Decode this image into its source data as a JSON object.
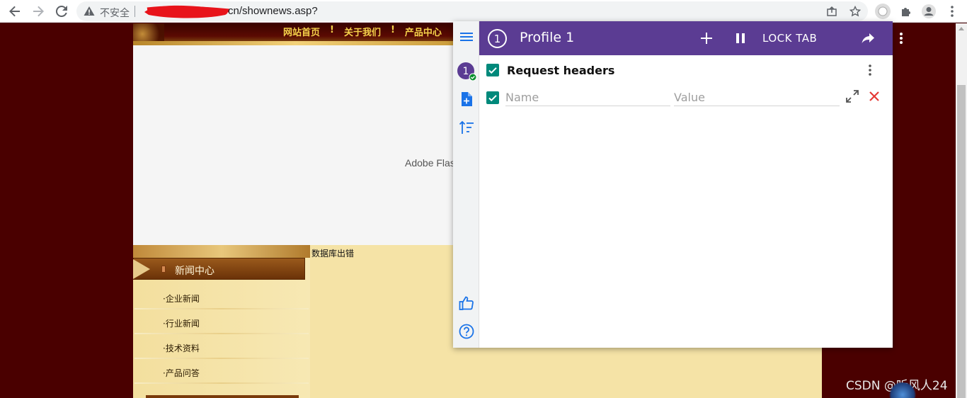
{
  "browser": {
    "security_label": "不安全",
    "url_visible": "cn/shownews.asp?"
  },
  "site": {
    "nav": [
      "网站首页",
      "关于我们",
      "产品中心"
    ],
    "nav_separator": "!",
    "flash_placeholder": "Adobe Flas",
    "news_center_title": "新闻中心",
    "sidebar_items": [
      "·企业新闻",
      "·行业新闻",
      "·技术资料",
      "·产品问答"
    ],
    "db_error": "数据库出错"
  },
  "extension": {
    "profile_number": "1",
    "profile_title": "Profile 1",
    "lock_tab_label": "LOCK TAB",
    "section_label": "Request headers",
    "name_placeholder": "Name",
    "value_placeholder": "Value",
    "accent_color": "#5b3c93",
    "check_color": "#00897b"
  },
  "watermark": "CSDN @听风人24"
}
